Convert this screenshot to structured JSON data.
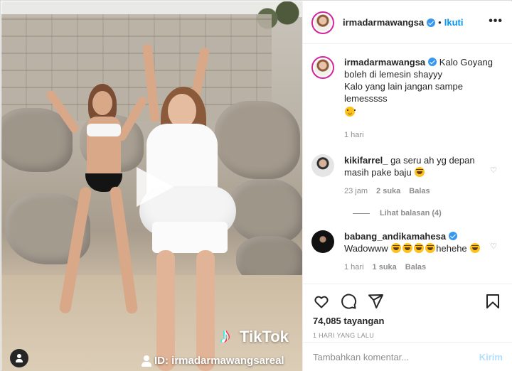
{
  "header": {
    "username": "irmadarmawangsa",
    "separator": "•",
    "follow_label": "Ikuti",
    "more_label": "•••"
  },
  "media": {
    "watermark_brand": "TikTok",
    "watermark_id": "ID: irmadarmawangsareal"
  },
  "caption": {
    "username": "irmadarmawangsa",
    "line1": "Kalo Goyang boleh di lemesin shayyy",
    "line2": "Kalo yang lain jangan sampe lemesssss",
    "time": "1 hari"
  },
  "comments": [
    {
      "username": "kikifarrel_",
      "text": "ga seru ah yg depan masih pake baju",
      "time": "23 jam",
      "likes": "2 suka",
      "reply_label": "Balas",
      "view_replies": "Lihat balasan (4)"
    },
    {
      "username": "babang_andikamahesa",
      "text": "Wadowww",
      "text_after": "hehehe",
      "time": "1 hari",
      "likes": "1 suka",
      "reply_label": "Balas"
    }
  ],
  "stats": {
    "views": "74,085 tayangan",
    "date": "1 HARI YANG LALU"
  },
  "composer": {
    "placeholder": "Tambahkan komentar...",
    "post_label": "Kirim"
  },
  "icons": {
    "like": "heart-icon",
    "comment": "comment-icon",
    "share": "share-icon",
    "save": "bookmark-icon",
    "verified": "verified-badge-icon",
    "emoji_laugh": "tears-of-joy-emoji",
    "emoji_smile": "smiling-emoji"
  },
  "colors": {
    "link_blue": "#0095f6",
    "verified_blue": "#3897f0",
    "muted_text": "#8e8e8e",
    "post_disabled": "#b2dffc"
  }
}
